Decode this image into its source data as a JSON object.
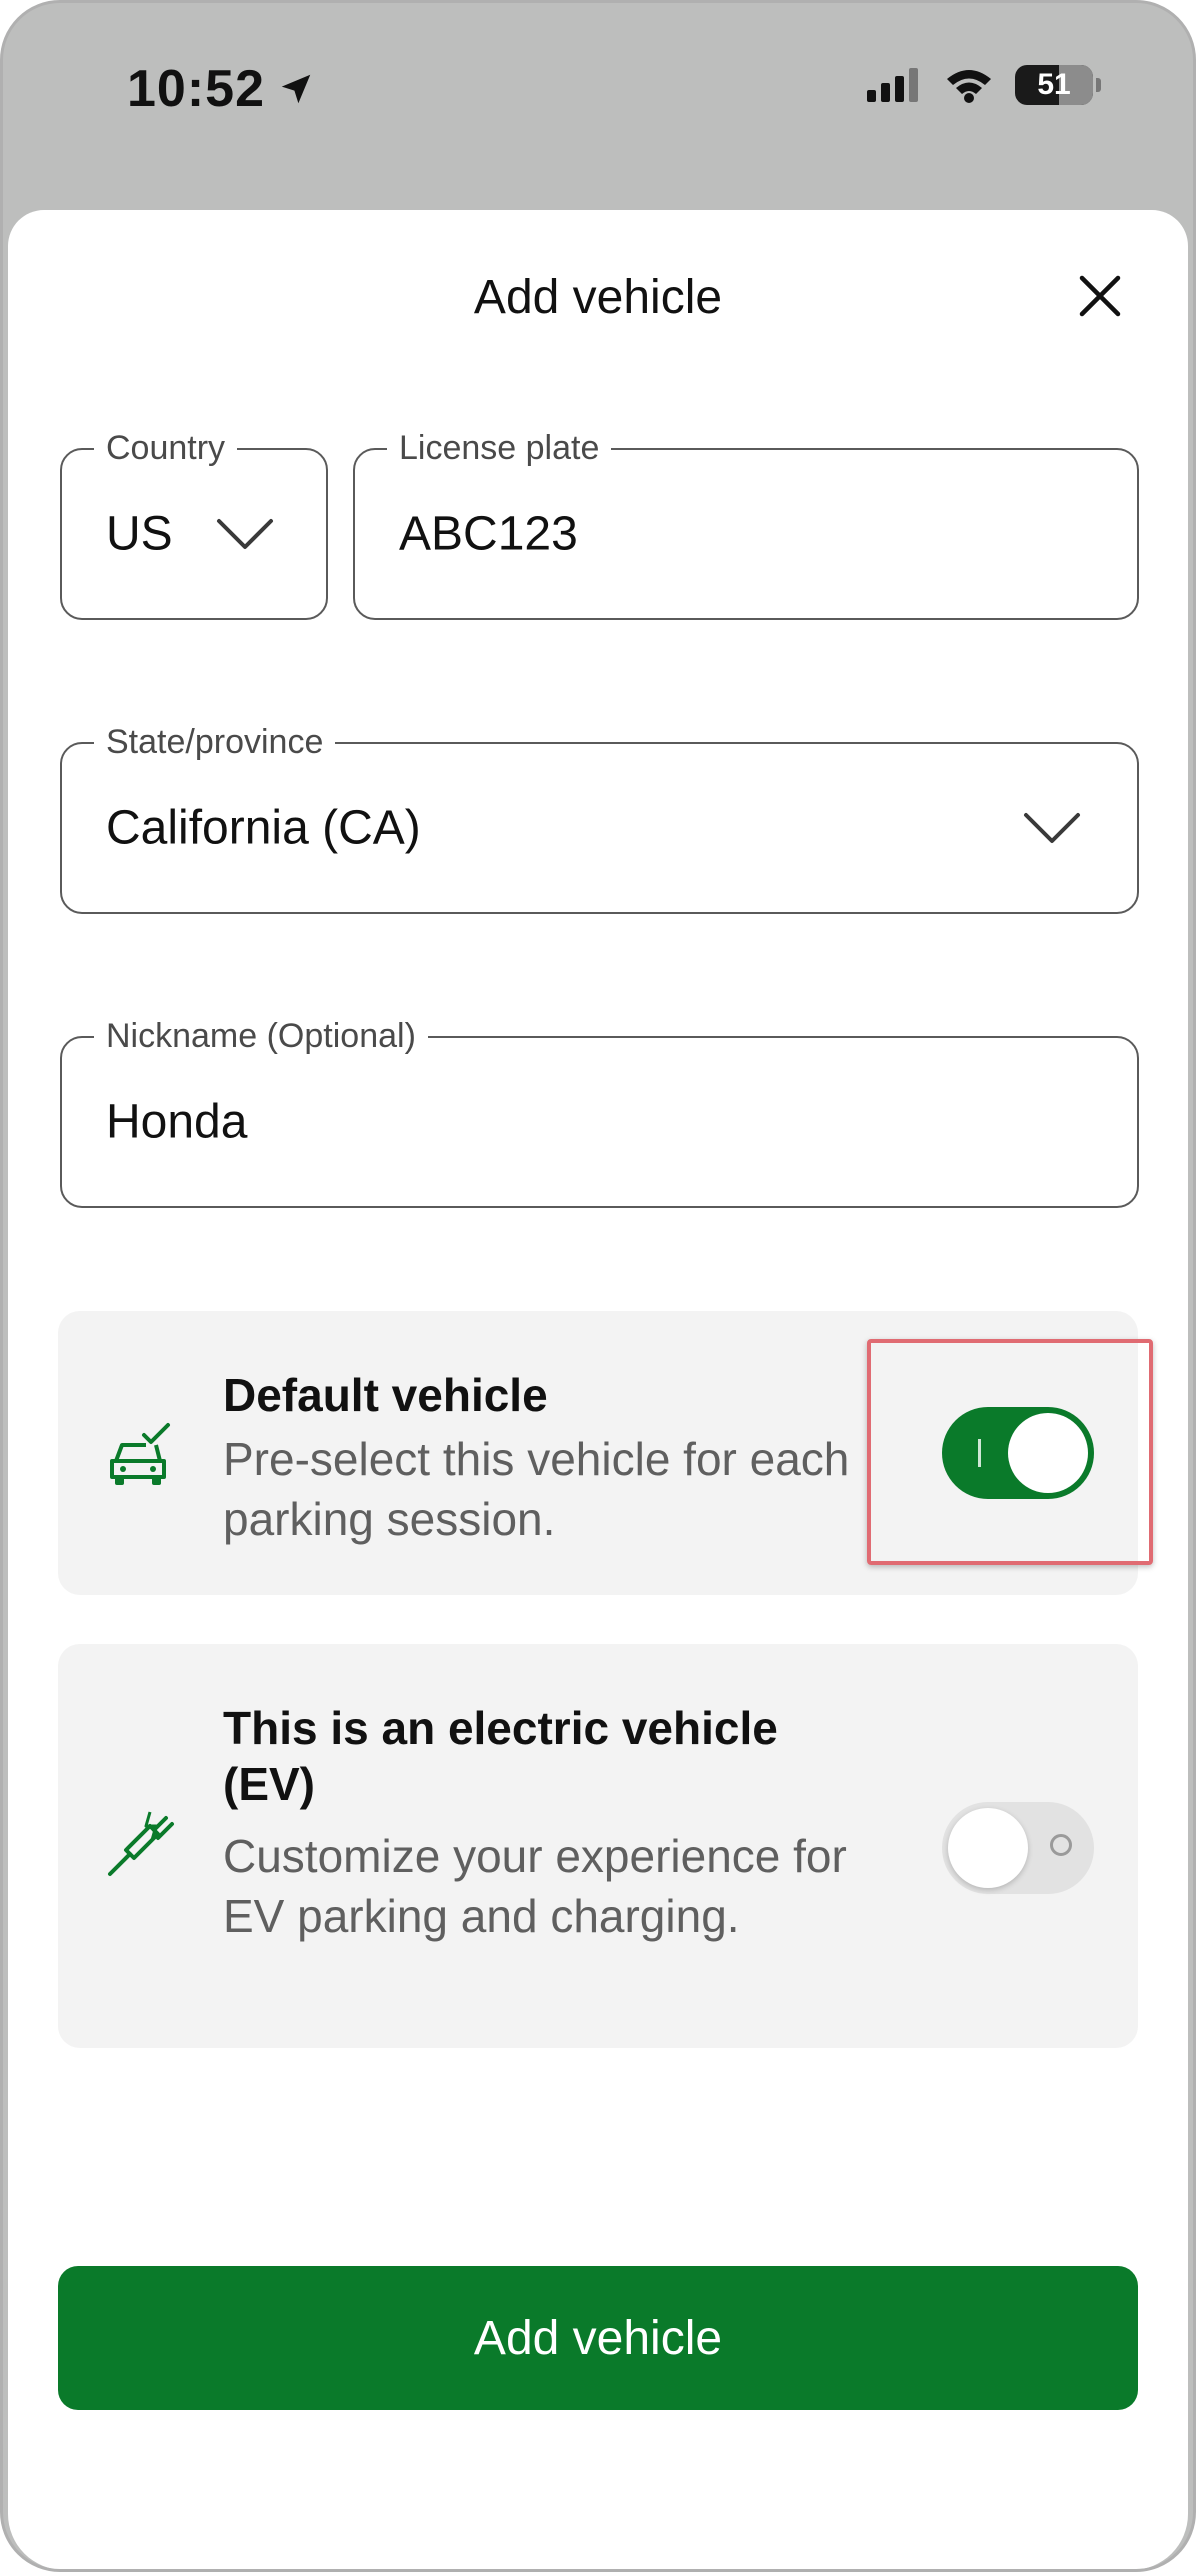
{
  "status_bar": {
    "time": "10:52",
    "battery_level": "51"
  },
  "sheet": {
    "title": "Add vehicle",
    "close_icon": "close-icon"
  },
  "form": {
    "country": {
      "label": "Country",
      "value": "US"
    },
    "license_plate": {
      "label": "License plate",
      "value": "ABC123"
    },
    "state_province": {
      "label": "State/province",
      "value": "California (CA)"
    },
    "nickname": {
      "label": "Nickname (Optional)",
      "value": "Honda"
    }
  },
  "default_vehicle": {
    "title": "Default vehicle",
    "description": "Pre-select this vehicle for each parking session.",
    "icon": "car-check-icon",
    "enabled": true
  },
  "electric_vehicle": {
    "title": "This is an electric vehicle (EV)",
    "description": "Customize your experience for EV parking and charging.",
    "icon": "ev-plug-icon",
    "enabled": false
  },
  "submit_button": {
    "label": "Add vehicle"
  },
  "colors": {
    "brand_green": "#0a7a2a",
    "highlight_red": "#e06b72"
  }
}
